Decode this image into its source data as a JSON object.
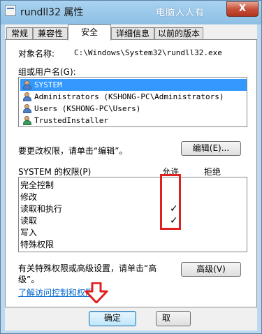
{
  "window": {
    "title": "rundll32 属性",
    "watermark": "电脑人人有",
    "close_label": "X"
  },
  "tabs": [
    {
      "label": "常规",
      "active": false
    },
    {
      "label": "兼容性",
      "active": false
    },
    {
      "label": "安全",
      "active": true
    },
    {
      "label": "详细信息",
      "active": false
    },
    {
      "label": "以前的版本",
      "active": false
    }
  ],
  "security": {
    "object_name_label": "对象名称:",
    "object_name_value": "C:\\Windows\\System32\\rundll32.exe",
    "group_label": "组或用户名(G):",
    "principals": [
      {
        "name": "SYSTEM",
        "selected": true,
        "icon": "user-group-icon"
      },
      {
        "name": "Administrators (KSHONG-PC\\Administrators)",
        "selected": false,
        "icon": "user-group-icon"
      },
      {
        "name": "Users (KSHONG-PC\\Users)",
        "selected": false,
        "icon": "user-group-icon"
      },
      {
        "name": "TrustedInstaller",
        "selected": false,
        "icon": "user-icon"
      }
    ],
    "change_hint": "要更改权限，请单击“编辑”。",
    "edit_button": "编辑(E)...",
    "perm_header": "SYSTEM 的权限(P)",
    "allow_header": "允许",
    "deny_header": "拒绝",
    "permissions": [
      {
        "name": "完全控制",
        "allow": false
      },
      {
        "name": "修改",
        "allow": false
      },
      {
        "name": "读取和执行",
        "allow": true
      },
      {
        "name": "读取",
        "allow": true
      },
      {
        "name": "写入",
        "allow": false
      },
      {
        "name": "特殊权限",
        "allow": false
      }
    ],
    "check_glyph": "✓",
    "advanced_hint_line1": "有关特殊权限或高级设置，请单击“高",
    "advanced_hint_line2": "级”。",
    "advanced_button": "高级(V)",
    "learn_link": "了解访问控制和权限"
  },
  "footer": {
    "ok_button": "确定",
    "cancel_button": "取"
  },
  "colors": {
    "highlight": "#3399ff",
    "annotation": "#e02020",
    "link": "#0066cc"
  }
}
